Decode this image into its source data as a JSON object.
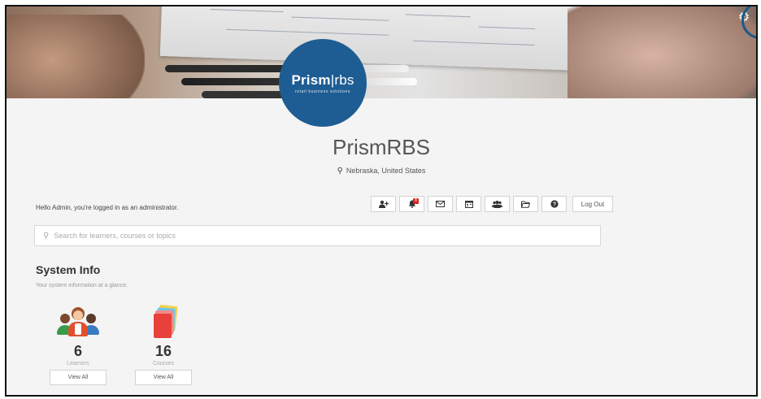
{
  "org": {
    "logo_main": "Prism",
    "logo_suffix": "rbs",
    "logo_tagline": "retail business solutions",
    "name": "PrismRBS",
    "location": "Nebraska, United States"
  },
  "greeting": "Hello Admin, you're logged in as an administrator.",
  "toolbar": {
    "add_user_icon": "user-plus-icon",
    "notifications_icon": "bell-icon",
    "notifications_count": "8",
    "messages_icon": "envelope-icon",
    "calendar_icon": "calendar-icon",
    "groups_icon": "users-icon",
    "folder_icon": "folder-icon",
    "help_icon": "question-icon",
    "logout_label": "Log Out"
  },
  "search": {
    "placeholder": "Search for learners, courses or topics"
  },
  "system_info": {
    "title": "System Info",
    "subtitle": "Your system information at a glance.",
    "learners": {
      "count": "6",
      "label": "Learners",
      "button": "View All"
    },
    "courses": {
      "count": "16",
      "label": "Courses",
      "button": "View All"
    }
  },
  "colors": {
    "brand": "#1e5d93",
    "badge": "#d9231d",
    "settings_highlight": "#1a5a8a"
  }
}
